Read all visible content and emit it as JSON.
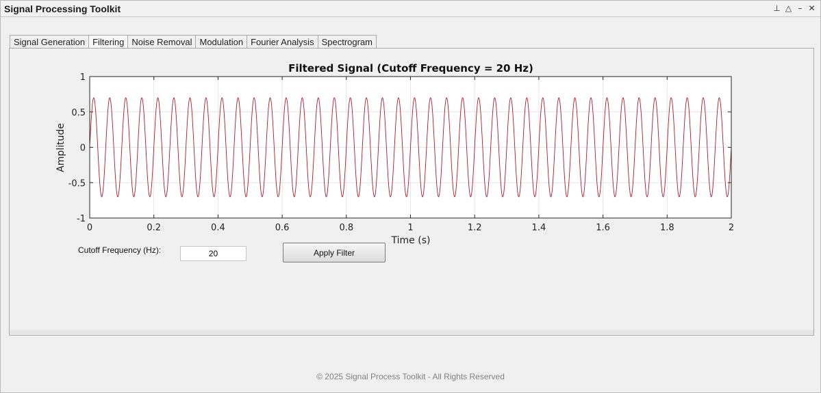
{
  "window": {
    "title": "Signal Processing Toolkit",
    "controls": [
      {
        "name": "pin-icon",
        "glyph": "⊥"
      },
      {
        "name": "undock-icon",
        "glyph": "△"
      },
      {
        "name": "minimize-icon",
        "glyph": "–"
      },
      {
        "name": "close-icon",
        "glyph": "✕"
      }
    ]
  },
  "tabs": [
    {
      "label": "Signal Generation",
      "active": false
    },
    {
      "label": "Filtering",
      "active": true
    },
    {
      "label": "Noise Removal",
      "active": false
    },
    {
      "label": "Modulation",
      "active": false
    },
    {
      "label": "Fourier Analysis",
      "active": false
    },
    {
      "label": "Spectrogram",
      "active": false
    }
  ],
  "chart_data": {
    "type": "line",
    "title": "Filtered Signal (Cutoff Frequency = 20 Hz)",
    "xlabel": "Time (s)",
    "ylabel": "Amplitude",
    "xlim": [
      0,
      2
    ],
    "ylim": [
      -1,
      1
    ],
    "xticks": [
      "0",
      "0.2",
      "0.4",
      "0.6",
      "0.8",
      "1",
      "1.2",
      "1.4",
      "1.6",
      "1.8",
      "2"
    ],
    "yticks": [
      "1",
      "0.5",
      "0",
      "-0.5",
      "-1"
    ],
    "grid": true,
    "series": [
      {
        "function": "sine",
        "amplitude": 0.7,
        "frequency_hz": 20,
        "phase": 0,
        "color": "#b2182b"
      }
    ]
  },
  "controls": {
    "cutoff_label": "Cutoff Frequency (Hz):",
    "cutoff_value": "20",
    "apply_label": "Apply Filter"
  },
  "footer": "© 2025 Signal Process Toolkit - All Rights Reserved"
}
